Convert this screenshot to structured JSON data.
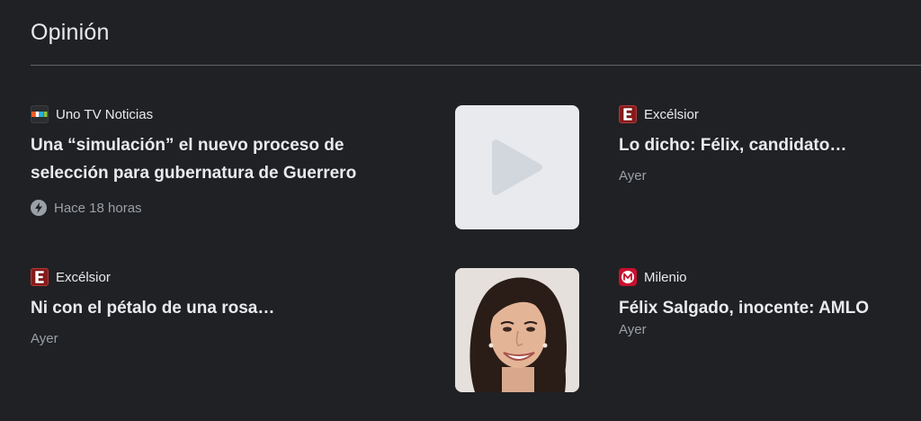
{
  "section": {
    "title": "Opinión"
  },
  "articles": [
    {
      "source": "Uno TV Noticias",
      "source_icon": "unotv-logo-icon",
      "headline_line1": "Una “simulación” el nuevo proceso de",
      "headline_line2": "selección para gubernatura de Guerrero",
      "time": "Hace 18 horas",
      "time_icon": "bolt-icon"
    },
    {
      "source": "Excélsior",
      "source_icon": "excelsior-logo-icon",
      "headline_line1": "Lo dicho: Félix, candidato…",
      "headline_line2": "",
      "time": "Ayer"
    },
    {
      "source": "Excélsior",
      "source_icon": "excelsior-logo-icon",
      "headline_line1": "Ni con el pétalo de una rosa…",
      "headline_line2": "",
      "time": "Ayer"
    },
    {
      "source": "Milenio",
      "source_icon": "milenio-logo-icon",
      "headline_line1": "Félix Salgado, inocente: AMLO",
      "headline_line2": "",
      "time": "Ayer"
    }
  ],
  "thumbnails": {
    "video_icon": "play-icon",
    "photo": "author-portrait"
  },
  "colors": {
    "background": "#202124",
    "text_primary": "#e8eaed",
    "text_secondary": "#9aa0a6",
    "divider": "#5f6368"
  }
}
